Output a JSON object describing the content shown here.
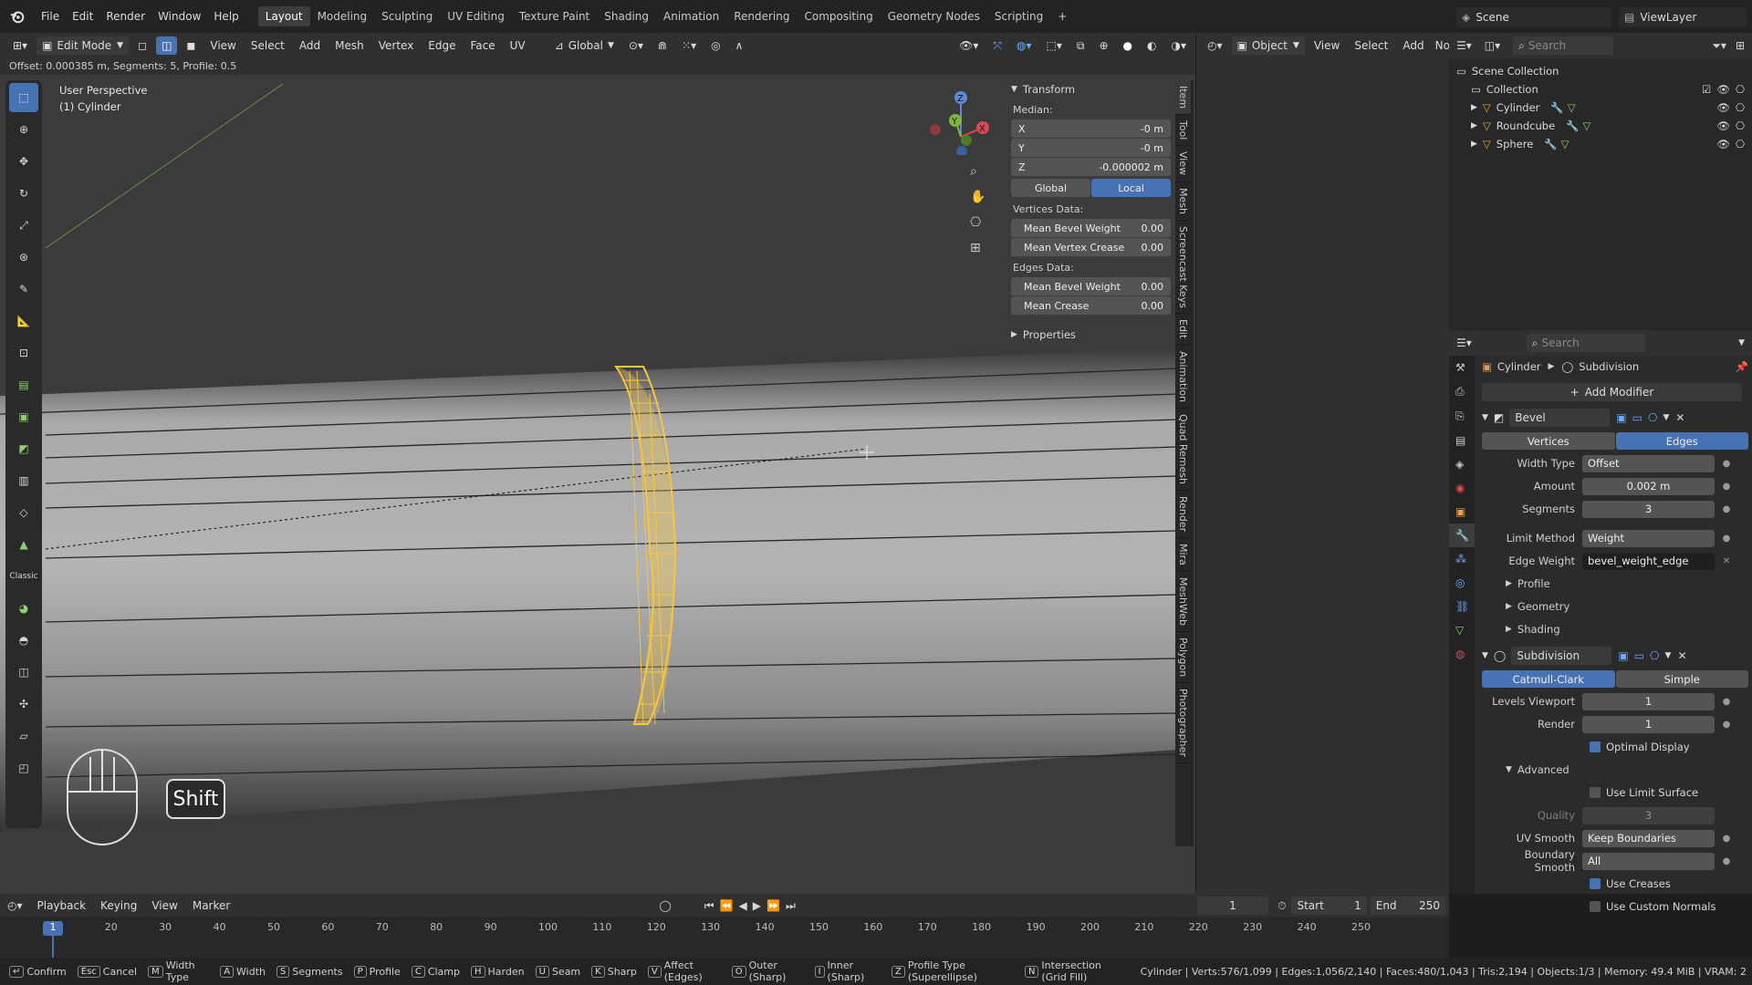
{
  "topbar": {
    "menus": [
      "File",
      "Edit",
      "Render",
      "Window",
      "Help"
    ],
    "workspaces": [
      "Layout",
      "Modeling",
      "Sculpting",
      "UV Editing",
      "Texture Paint",
      "Shading",
      "Animation",
      "Rendering",
      "Compositing",
      "Geometry Nodes",
      "Scripting"
    ],
    "active_workspace": "Layout",
    "scene": "Scene",
    "view_layer": "ViewLayer"
  },
  "viewport_header": {
    "mode": "Edit Mode",
    "menus": [
      "View",
      "Select",
      "Add",
      "Mesh",
      "Vertex",
      "Edge",
      "Face",
      "UV"
    ],
    "orientation": "Global",
    "right_mode": "Object",
    "right_menus": [
      "View",
      "Select",
      "Add",
      "No"
    ],
    "search_placeholder": "Search"
  },
  "operator_line": "Offset: 0.000385 m, Segments: 5, Profile: 0.5",
  "viewport": {
    "perspective": "User Perspective",
    "object": "(1) Cylinder",
    "shift_key": "Shift",
    "gizmo": {
      "x": "X",
      "y": "Y",
      "z": "Z"
    }
  },
  "npanel": {
    "section": "Transform",
    "median_label": "Median:",
    "x_label": "X",
    "x_value": "-0 m",
    "y_label": "Y",
    "y_value": "-0 m",
    "z_label": "Z",
    "z_value": "-0.000002 m",
    "global": "Global",
    "local": "Local",
    "vertices_label": "Vertices Data:",
    "mean_bevel_weight_v": "Mean Bevel Weight",
    "mean_bevel_weight_v_value": "0.00",
    "mean_vertex_crease": "Mean Vertex Crease",
    "mean_vertex_crease_value": "0.00",
    "edges_label": "Edges Data:",
    "mean_bevel_weight_e": "Mean Bevel Weight",
    "mean_bevel_weight_e_value": "0.00",
    "mean_crease": "Mean Crease",
    "mean_crease_value": "0.00",
    "properties": "Properties"
  },
  "vertical_tabs": [
    "Item",
    "Tool",
    "View",
    "Mesh",
    "Screencast Keys",
    "Edit",
    "Animation",
    "Quad Remesh",
    "Render",
    "Mira",
    "MeshWeb",
    "Polygon",
    "Photographer"
  ],
  "outliner": {
    "search_placeholder": "Search",
    "scene_collection": "Scene Collection",
    "collection": "Collection",
    "items": [
      "Cylinder",
      "Roundcube",
      "Sphere"
    ]
  },
  "properties": {
    "search_placeholder": "Search",
    "breadcrumb_object": "Cylinder",
    "breadcrumb_modifier": "Subdivision",
    "add_modifier": "Add Modifier",
    "bevel": {
      "name": "Bevel",
      "vertices": "Vertices",
      "edges": "Edges",
      "width_type_label": "Width Type",
      "width_type": "Offset",
      "amount_label": "Amount",
      "amount": "0.002 m",
      "segments_label": "Segments",
      "segments": "3",
      "limit_method_label": "Limit Method",
      "limit_method": "Weight",
      "edge_weight_label": "Edge Weight",
      "edge_weight": "bevel_weight_edge",
      "profile": "Profile",
      "geometry": "Geometry",
      "shading": "Shading"
    },
    "subdivision": {
      "name": "Subdivision",
      "catmull": "Catmull-Clark",
      "simple": "Simple",
      "levels_viewport_label": "Levels Viewport",
      "levels_viewport": "1",
      "render_label": "Render",
      "render": "1",
      "optimal_display": "Optimal Display",
      "advanced": "Advanced",
      "use_limit_surface": "Use Limit Surface",
      "quality_label": "Quality",
      "quality": "3",
      "uv_smooth_label": "UV Smooth",
      "uv_smooth": "Keep Boundaries",
      "boundary_smooth_label": "Boundary Smooth",
      "boundary_smooth": "All",
      "use_creases": "Use Creases",
      "use_custom_normals": "Use Custom Normals"
    }
  },
  "timeline": {
    "menus": [
      "Playback",
      "Keying",
      "View",
      "Marker"
    ],
    "current_frame": "1",
    "start_label": "Start",
    "start": "1",
    "end_label": "End",
    "end": "250",
    "ticks": [
      "1",
      "10",
      "20",
      "30",
      "40",
      "50",
      "60",
      "70",
      "80",
      "90",
      "100",
      "110",
      "120",
      "130",
      "140",
      "150",
      "160",
      "170",
      "180",
      "190",
      "200",
      "210",
      "220",
      "230",
      "240",
      "250"
    ]
  },
  "statusbar": {
    "items": [
      {
        "key": "↵",
        "label": "Confirm"
      },
      {
        "key": "Esc",
        "label": "Cancel"
      },
      {
        "key": "M",
        "label": "Width Type"
      },
      {
        "key": "A",
        "label": "Width"
      },
      {
        "key": "S",
        "label": "Segments"
      },
      {
        "key": "P",
        "label": "Profile"
      },
      {
        "key": "C",
        "label": "Clamp"
      },
      {
        "key": "H",
        "label": "Harden"
      },
      {
        "key": "U",
        "label": "Seam"
      },
      {
        "key": "K",
        "label": "Sharp"
      },
      {
        "key": "V",
        "label": "Affect (Edges)"
      },
      {
        "key": "O",
        "label": "Outer (Sharp)"
      },
      {
        "key": "I",
        "label": "Inner (Sharp)"
      },
      {
        "key": "Z",
        "label": "Profile Type (Superellipse)"
      },
      {
        "key": "N",
        "label": "Intersection (Grid Fill)"
      }
    ],
    "stats": "Cylinder | Verts:576/1,099 | Edges:1,056/2,140 | Faces:480/1,043 | Tris:2,194 | Objects:1/3 | Memory: 49.4 MiB | VRAM: 2"
  },
  "colors": {
    "accent": "#4772b3",
    "selection": "#f5c542"
  }
}
